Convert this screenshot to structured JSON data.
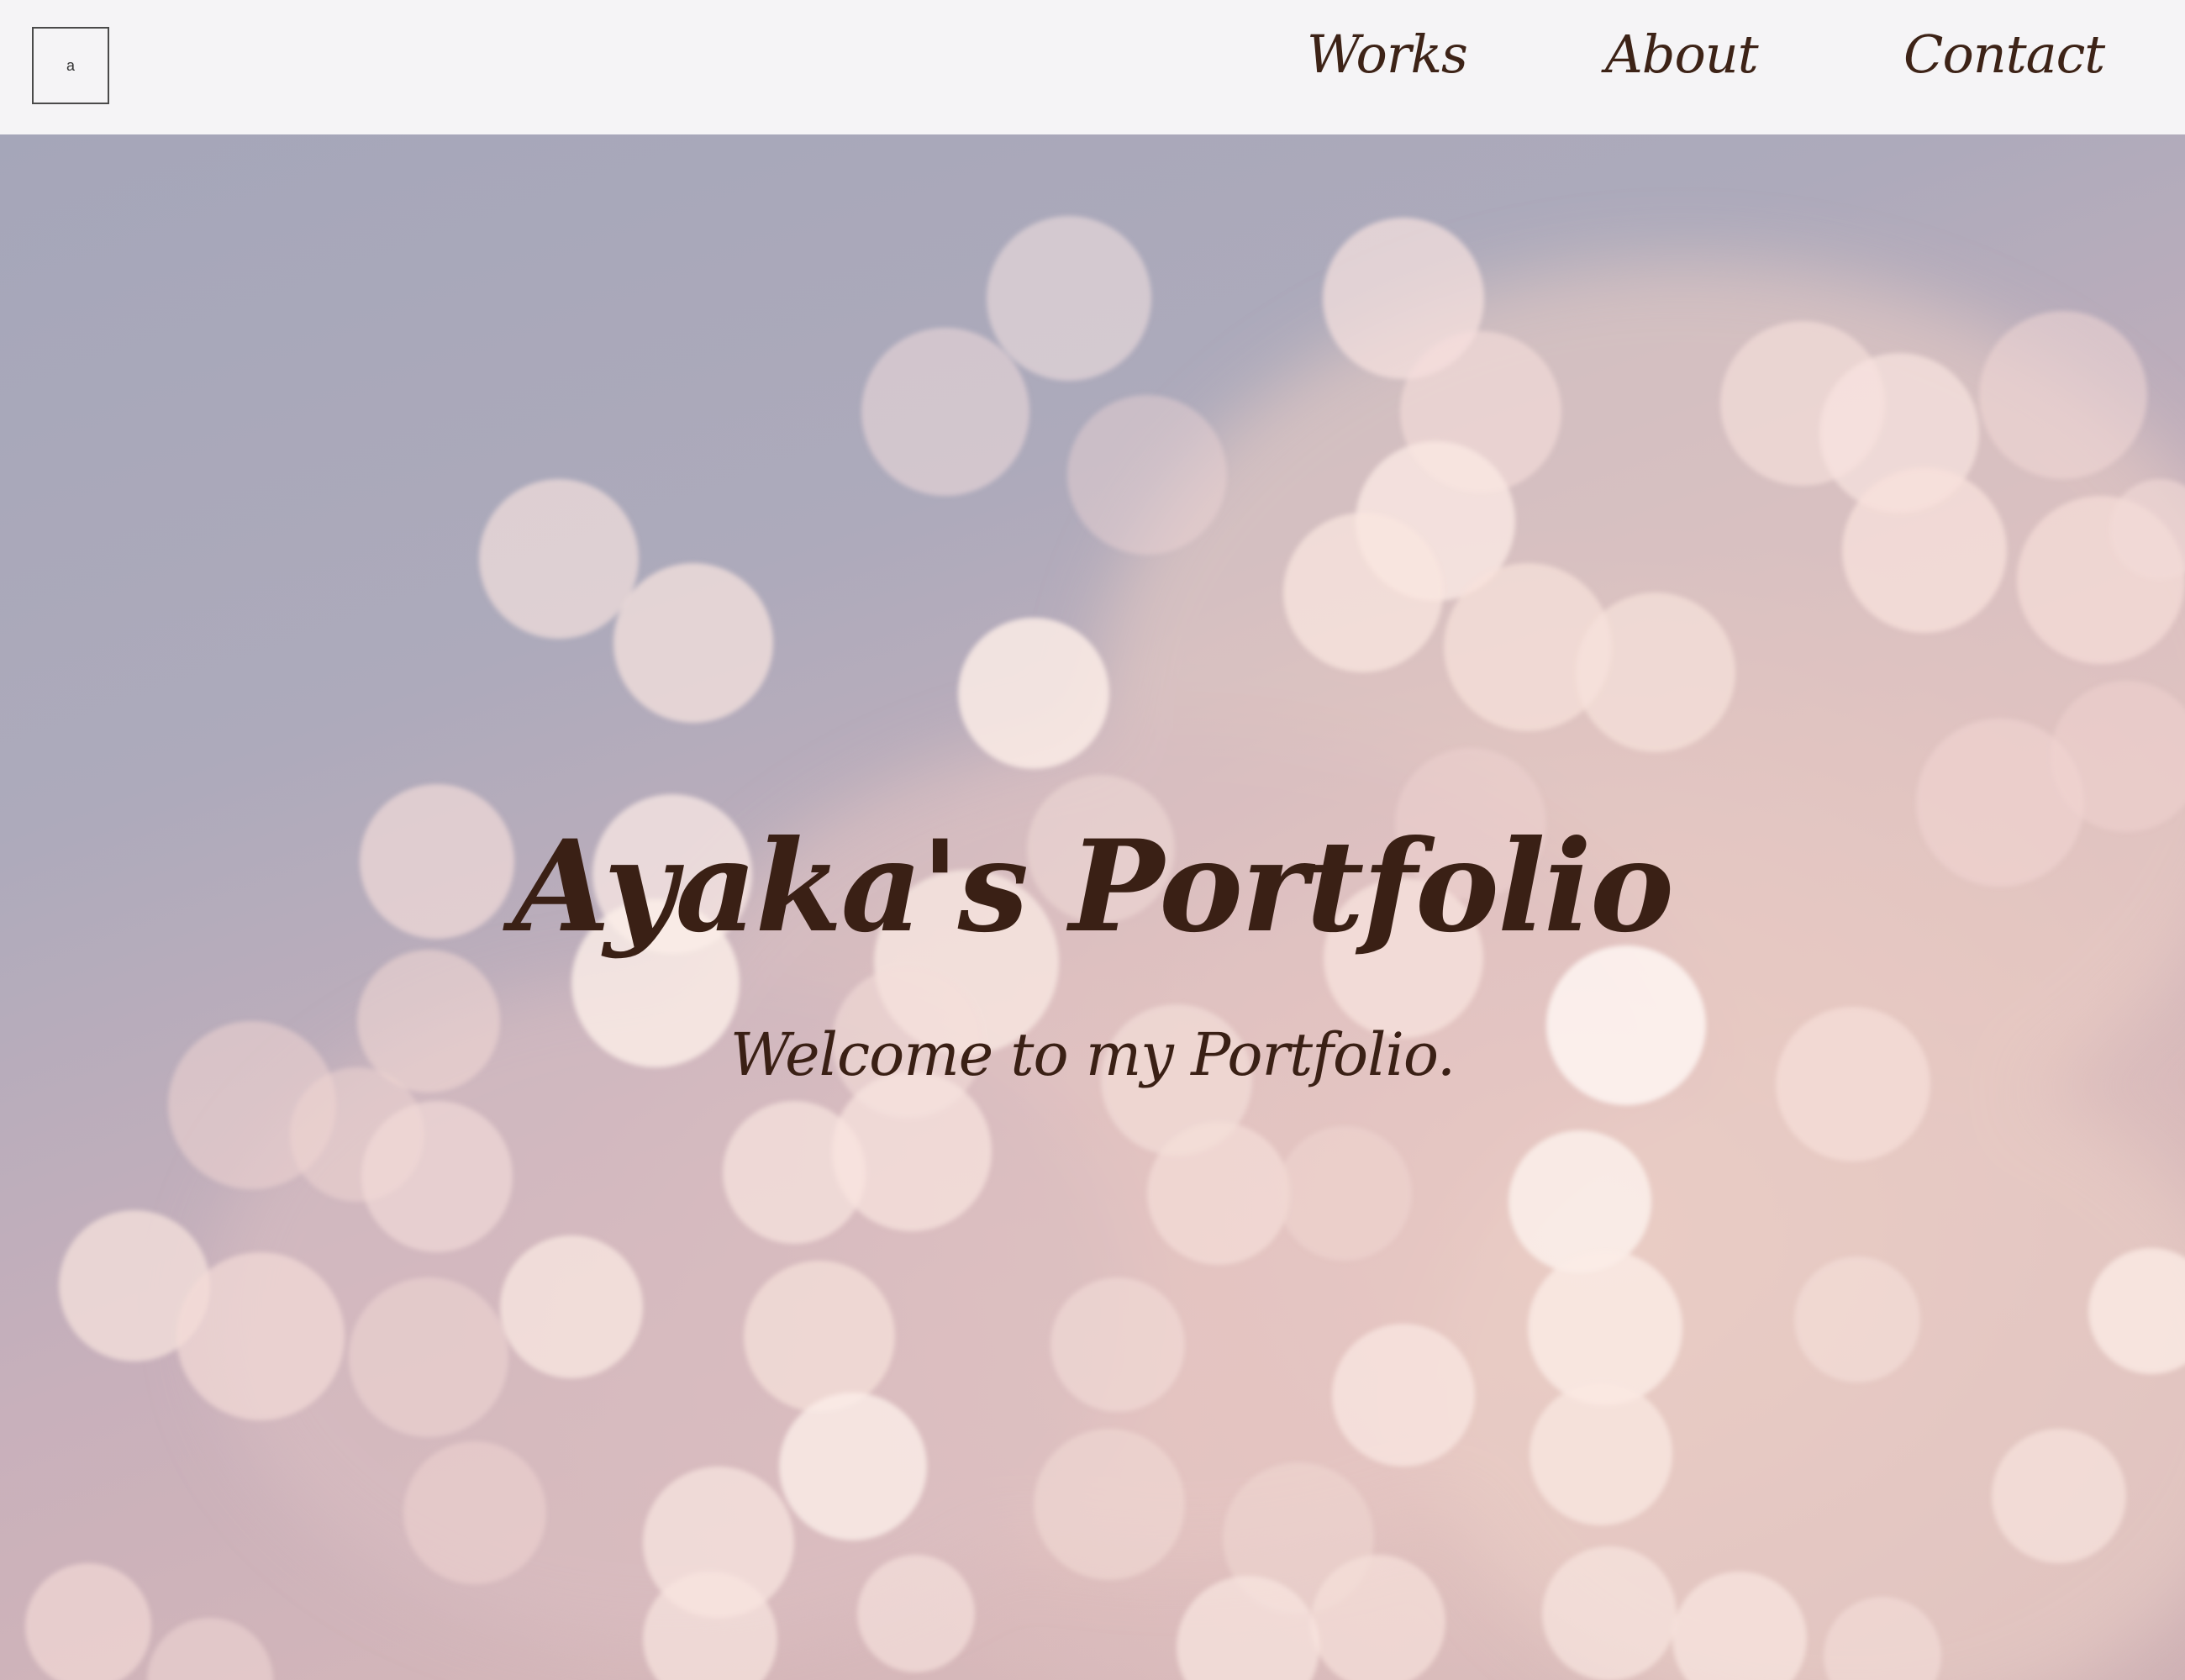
{
  "header": {
    "logo_text": "a",
    "nav": {
      "works": "Works",
      "about": "About",
      "contact": "Contact"
    }
  },
  "hero": {
    "title": "Ayaka's Portfolio",
    "subtitle": "Welcome to my Portfolio."
  },
  "colors": {
    "header_bg": "#f5f4f6",
    "text": "#3d2317",
    "hero_blue": "#a5a6b9",
    "hero_pink": "#e8c9c2",
    "bokeh_light": "#fbe7df"
  }
}
